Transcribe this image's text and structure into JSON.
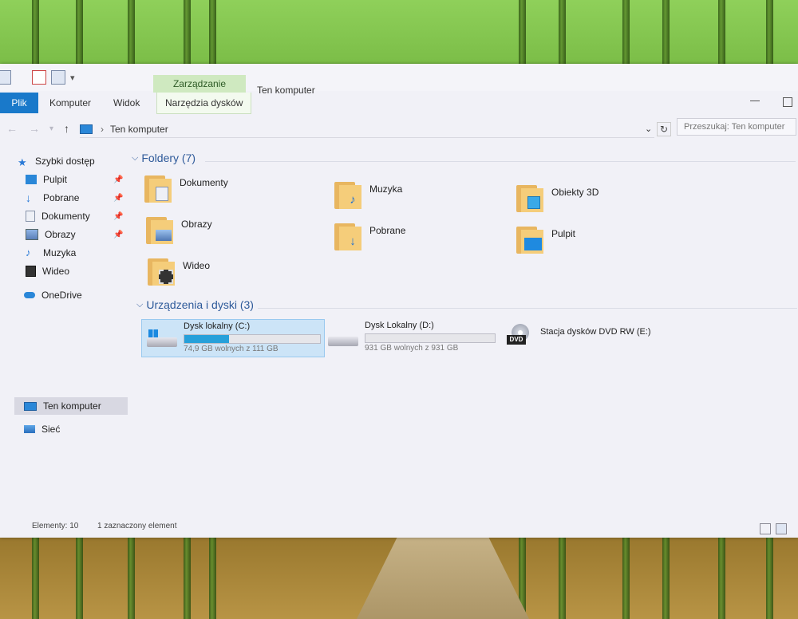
{
  "ribbon": {
    "context_group": "Zarządzanie",
    "window_title": "Ten komputer",
    "tabs": {
      "file": "Plik",
      "computer": "Komputer",
      "view": "Widok",
      "disk_tools": "Narzędzia dysków"
    }
  },
  "address": {
    "breadcrumb": "Ten komputer",
    "search_placeholder": "Przeszukaj: Ten komputer"
  },
  "nav": {
    "quick_access": "Szybki dostęp",
    "pinned": [
      "Pulpit",
      "Pobrane",
      "Dokumenty",
      "Obrazy"
    ],
    "music": "Muzyka",
    "video": "Wideo",
    "onedrive": "OneDrive",
    "this_pc": "Ten komputer",
    "network": "Sieć"
  },
  "folders_group": {
    "title": "Foldery (7)"
  },
  "folders": {
    "documents": "Dokumenty",
    "music": "Muzyka",
    "objects3d": "Obiekty 3D",
    "pictures": "Obrazy",
    "downloads": "Pobrane",
    "desktop": "Pulpit",
    "videos": "Wideo"
  },
  "devices_group": {
    "title": "Urządzenia i dyski (3)"
  },
  "drives": {
    "c": {
      "name": "Dysk lokalny (C:)",
      "free": "74,9 GB wolnych z 111 GB",
      "used_fraction": 0.33
    },
    "d": {
      "name": "Dysk Lokalny (D:)",
      "free": "931 GB wolnych z 931 GB",
      "used_fraction": 0.0
    },
    "e": {
      "name": "Stacja dysków DVD RW (E:)",
      "badge": "DVD"
    }
  },
  "status": {
    "count": "Elementy: 10",
    "selected": "1 zaznaczony element"
  },
  "colors": {
    "accent": "#1979ca",
    "selection": "#cce4f7",
    "drive_fill": "#26a0da"
  }
}
